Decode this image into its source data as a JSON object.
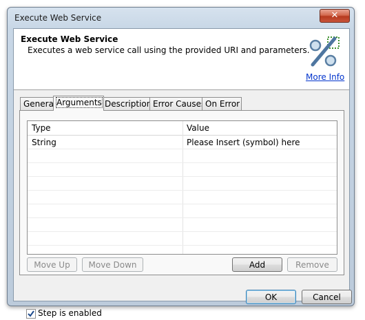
{
  "window": {
    "title": "Execute Web Service",
    "close_glyph": "✕"
  },
  "header": {
    "title": "Execute Web Service",
    "description": "Executes a web service call using the provided URI and parameters.",
    "icon": "percent-icon",
    "more_info": "More Info"
  },
  "tabs": [
    {
      "label": "General",
      "active": false
    },
    {
      "label": "Arguments",
      "active": true
    },
    {
      "label": "Description",
      "active": false
    },
    {
      "label": "Error Causes",
      "active": false
    },
    {
      "label": "On Error",
      "active": false
    }
  ],
  "table": {
    "columns": [
      "Type",
      "Value"
    ],
    "rows": [
      [
        "String",
        "Please Insert (symbol) here"
      ]
    ]
  },
  "buttons": {
    "move_up": "Move Up",
    "move_down": "Move Down",
    "add": "Add",
    "remove": "Remove",
    "ok": "OK",
    "cancel": "Cancel"
  },
  "step_enabled": {
    "label": "Step is enabled",
    "checked": true
  },
  "colors": {
    "link": "#0033cc",
    "close_button": "#c9553b"
  }
}
